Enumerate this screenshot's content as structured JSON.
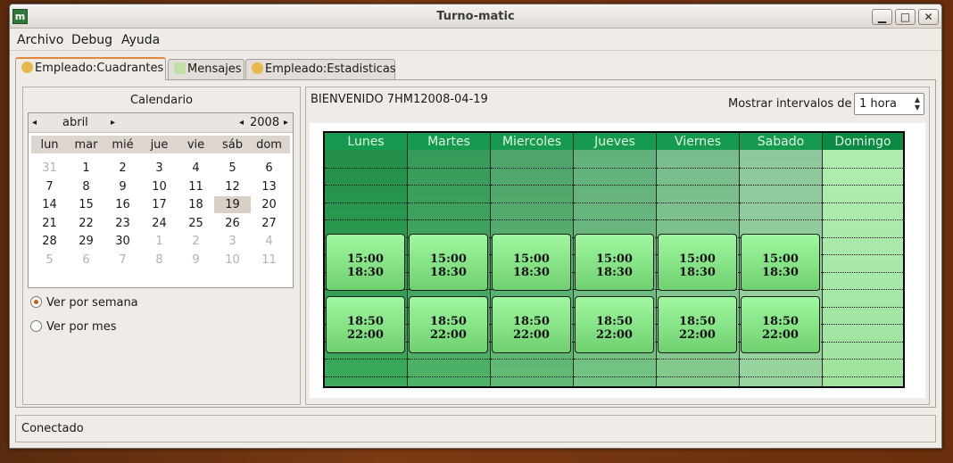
{
  "window": {
    "title": "Turno-matic",
    "app_icon": "m",
    "controls": {
      "minimize": "▁",
      "maximize": "□",
      "close": "✕"
    }
  },
  "menu": [
    "Archivo",
    "Debug",
    "Ayuda"
  ],
  "tabs": [
    {
      "label": "Empleado:Cuadrantes",
      "icon": "user-icon",
      "active": true
    },
    {
      "label": "Mensajes",
      "icon": "mail-icon",
      "active": false
    },
    {
      "label": "Empleado:Estadisticas",
      "icon": "user-icon",
      "active": false
    }
  ],
  "calendar": {
    "title": "Calendario",
    "month": "abril",
    "year": "2008",
    "prev_month": "◂",
    "next_month": "▸",
    "prev_year": "◂",
    "next_year": "▸",
    "weekdays": [
      "lun",
      "mar",
      "mié",
      "jue",
      "vie",
      "sáb",
      "dom"
    ],
    "weeks": [
      [
        "31",
        "1",
        "2",
        "3",
        "4",
        "5",
        "6"
      ],
      [
        "7",
        "8",
        "9",
        "10",
        "11",
        "12",
        "13"
      ],
      [
        "14",
        "15",
        "16",
        "17",
        "18",
        "19",
        "20"
      ],
      [
        "21",
        "22",
        "23",
        "24",
        "25",
        "26",
        "27"
      ],
      [
        "28",
        "29",
        "30",
        "1",
        "2",
        "3",
        "4"
      ],
      [
        "5",
        "6",
        "7",
        "8",
        "9",
        "10",
        "11"
      ]
    ],
    "selected_day": "19"
  },
  "view_options": [
    {
      "label": "Ver por semana",
      "checked": true
    },
    {
      "label": "Ver por mes",
      "checked": false
    }
  ],
  "schedule": {
    "welcome": "BIENVENIDO 7HM12008-04-19",
    "interval_label": "Mostrar intervalos de",
    "interval_value": "1 hora",
    "days": [
      "Lunes",
      "Martes",
      "Miercoles",
      "Jueves",
      "Viernes",
      "Sabado",
      "Domingo"
    ],
    "shifts": [
      {
        "start": "15:00",
        "end": "18:30",
        "days": 6
      },
      {
        "start": "18:50",
        "end": "22:00",
        "days": 6
      }
    ]
  },
  "status": "Conectado"
}
